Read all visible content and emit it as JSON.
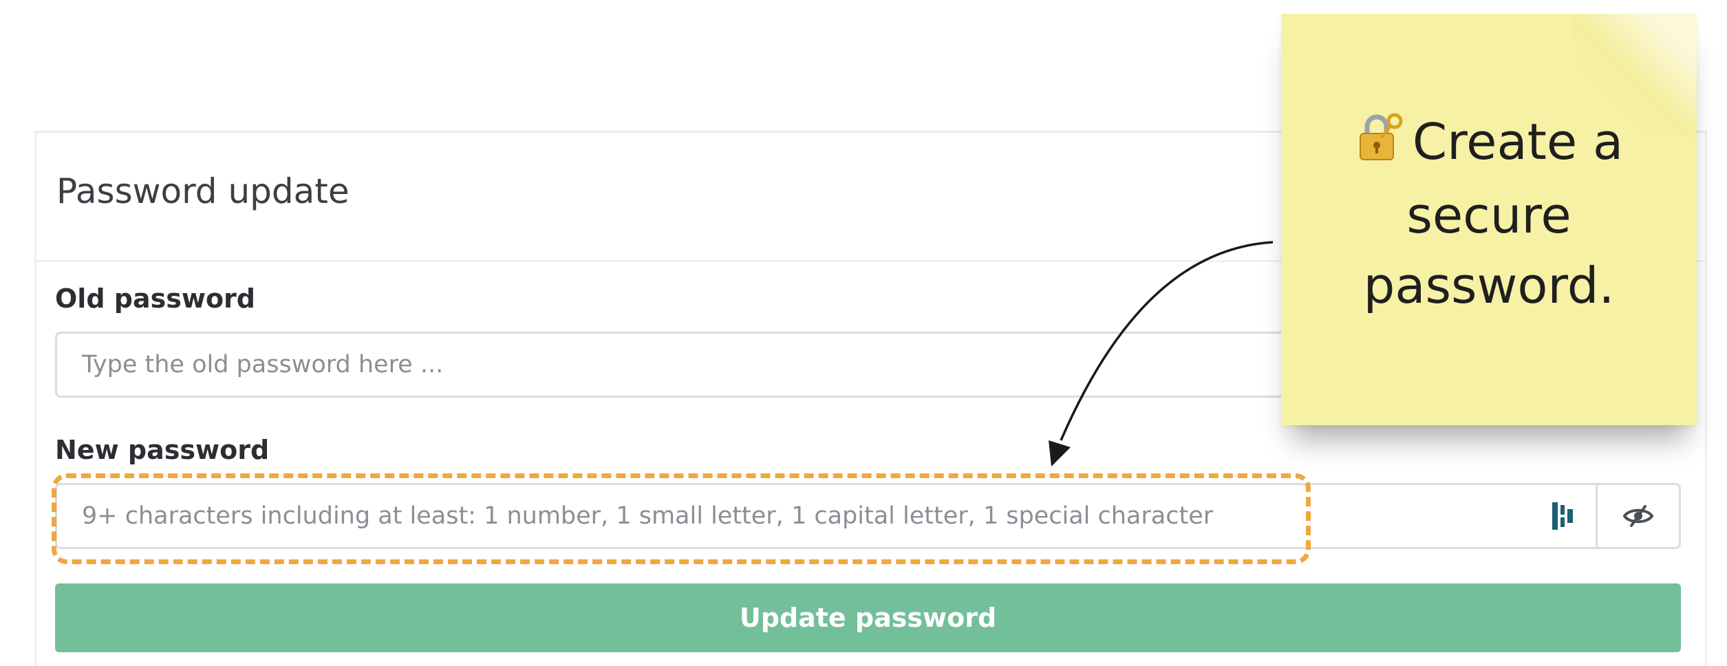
{
  "form": {
    "title": "Password update",
    "old_password": {
      "label": "Old password",
      "placeholder": "Type the old password here ..."
    },
    "new_password": {
      "label": "New password",
      "placeholder": "9+ characters including at least: 1 number, 1 small letter, 1 capital letter, 1 special character"
    },
    "submit_label": "Update password"
  },
  "sticky_note": {
    "icon": "lock-with-key-icon",
    "text_line1": "Create a",
    "text_line2": "secure",
    "text_line3": "password."
  },
  "colors": {
    "submit_button": "#72bf9a",
    "highlight_border": "#f0a742",
    "sticky_note": "#f7f1a6",
    "password_manager_icon": "#1e5f74"
  }
}
